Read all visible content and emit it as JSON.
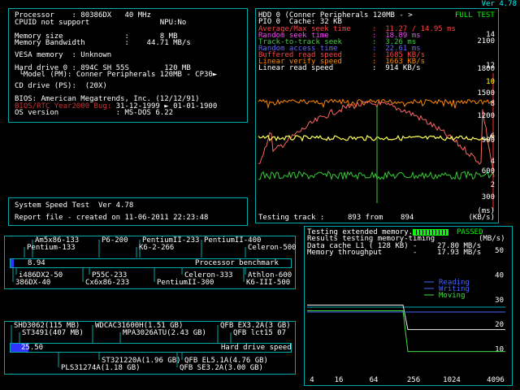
{
  "version": "Ver 4.78",
  "sysinfo": {
    "line1": "Processor    : 80386DX   40 MHz",
    "line2": "CPUID not support                NPU:No",
    "line3": "Memory size              :       8 MB",
    "line4": "Memory Bandwidth         :    44.71 MB/s",
    "line5": "VESA memory  : Unknown",
    "line6": "Hard drive 0 : 894C SH 55S        120 MB",
    "line7": " └Model (PM): Conner Peripherals 120MB - CP30►",
    "line8": "CD drive (PS):  (20X)",
    "line9": "BIOS: American Megatrends, Inc. (12/12/91)",
    "bios_bug_label": "BIOS/RTC Year2000 Bug:",
    "bios_bug_value": " 31-12-1999 ► 01-01-1900",
    "line11": "OS version             : MS-DOS 6.22"
  },
  "speedtest": {
    "title": "System Speed Test  Ver 4.78",
    "report": "Report file - created on 11-06-2011 22:23:48"
  },
  "hdd": {
    "header_left": "HDD 0 (Conner Peripherals 120MB - >",
    "header_right": "FULL TEST",
    "pio_line": "PIO 0  Cache: 32 KB",
    "stats": [
      {
        "label": "Average/Max seek time",
        "value": "11.27 / 14.95 ms",
        "color": "#ff4444"
      },
      {
        "label": "Random seek time",
        "value": "18.89 ms",
        "color": "#ff44ff"
      },
      {
        "label": "Track-to-track seek",
        "value": "3.26 ms",
        "color": "#44cc44"
      },
      {
        "label": "Random access time",
        "value": "22.61 ms",
        "color": "#6666ff"
      },
      {
        "label": "Buffered read speed",
        "value": "1685 KB/s",
        "color": "#ff4444"
      },
      {
        "label": "Linear verify speed",
        "value": "1663 KB/s",
        "color": "#ff8800"
      },
      {
        "label": "Linear read speed",
        "value": "914 KB/s",
        "color": "#ffffff"
      }
    ],
    "right_axis": [
      {
        "text": "14",
        "color": "#fff"
      },
      {
        "text": "2100",
        "color": "#fff"
      },
      {
        "text": "12",
        "color": "#fff"
      },
      {
        "text": "1800",
        "color": "#fff"
      },
      {
        "text": "10",
        "color": "#ff0"
      },
      {
        "text": "1500",
        "color": "#fff"
      },
      {
        "text": "8",
        "color": "#fff"
      },
      {
        "text": "1200",
        "color": "#fff"
      },
      {
        "text": "6",
        "color": "#fff"
      },
      {
        "text": "900",
        "color": "#fff"
      },
      {
        "text": "4",
        "color": "#fff"
      },
      {
        "text": "600",
        "color": "#fff"
      },
      {
        "text": "2",
        "color": "#fff"
      },
      {
        "text": "300",
        "color": "#fff"
      },
      {
        "text": "(ms)",
        "color": "#fff"
      },
      {
        "text": "(KB/s)",
        "color": "#fff"
      }
    ],
    "testing_label": "Testing track :",
    "testing_value": "893 from    894"
  },
  "cpu_bench": {
    "top_labels": [
      "Am5x86-133",
      "P6-200",
      "PentiumII-233",
      "PentiumII-400",
      "Pentium-133",
      "K6-2-266",
      "Celeron-500"
    ],
    "bottom_labels": [
      "i486DX2-50",
      "P55C-233",
      "Celeron-333",
      "Athlon-600",
      "386DX-40",
      "Cx6x86-233",
      "PentiumII-300",
      "K6-III-500"
    ],
    "score": "8.94",
    "caption": "Processor benchmark",
    "bar_fraction": 0.012
  },
  "hdd_bench": {
    "top_labels": [
      "SHD3062(115 MB)",
      "WDCAC31600H(1.51 GB)",
      "QFB EX3.2A(3 GB)",
      "ST3491(407 MB)",
      "MPA3026ATU(2.43 GB)",
      "QFB lct15 07"
    ],
    "bottom_labels": [
      "ST321220A(1.96 GB)",
      "QFB EL5.1A(4.76 GB)",
      "PLS31274A(1.18 GB)",
      "QFB SE3.2A(3.00 GB)"
    ],
    "score": "25.50",
    "caption": "Hard drive speed",
    "bar_fraction": 0.065
  },
  "memtest": {
    "line1": "Testing extended memory...",
    "passed": "PASSED",
    "line2": "Results testing memory-timing",
    "unit": "(MB/s)",
    "l1_label": "Data cache L1 ( 128 KB) -",
    "l1_value": "27.80 MB/s",
    "mem_label": "Memory throughput       -",
    "mem_value": "17.93 MB/s",
    "legend": [
      {
        "name": "Reading",
        "color": "#4466ff"
      },
      {
        "name": "Writing",
        "color": "#4466ff"
      },
      {
        "name": "Moving",
        "color": "#44dd44"
      }
    ],
    "y_ticks": [
      "50",
      "40",
      "30",
      "20",
      "10"
    ],
    "x_ticks": [
      "4",
      "16",
      "64",
      "256",
      "1024",
      "4096"
    ]
  },
  "chart_data": [
    {
      "type": "line",
      "title": "HDD 0 (Conner Peripherals 120MB - >",
      "x": [
        0,
        100,
        200,
        300,
        400,
        500,
        600,
        700,
        800,
        894
      ],
      "series": [
        {
          "name": "Linear read speed",
          "values": [
            1000,
            1000,
            995,
            1000,
            990,
            1000,
            995,
            1000,
            990,
            980
          ]
        },
        {
          "name": "Linear verify speed",
          "values": [
            1820,
            1830,
            1810,
            1820,
            1830,
            1820,
            1810,
            1830,
            1810,
            1800
          ]
        },
        {
          "name": "Buffered read speed",
          "values": [
            1100,
            1400,
            1600,
            1700,
            1750,
            1750,
            1700,
            1600,
            1400,
            1000
          ]
        }
      ],
      "right_ylim_kbs": [
        300,
        2100
      ],
      "left_ylim_ms": [
        2,
        14
      ]
    },
    {
      "type": "line",
      "title": "Results testing memory-timing",
      "x": [
        4,
        16,
        64,
        256,
        1024,
        4096
      ],
      "series": [
        {
          "name": "Reading",
          "values": [
            27.8,
            27.8,
            27.8,
            17.9,
            17.9,
            17.9
          ]
        },
        {
          "name": "Writing",
          "values": [
            25,
            25,
            25,
            25,
            25,
            25
          ]
        },
        {
          "name": "Moving",
          "values": [
            25.5,
            25.5,
            25.5,
            9,
            9,
            9
          ]
        }
      ],
      "ylim": [
        0,
        50
      ]
    }
  ]
}
